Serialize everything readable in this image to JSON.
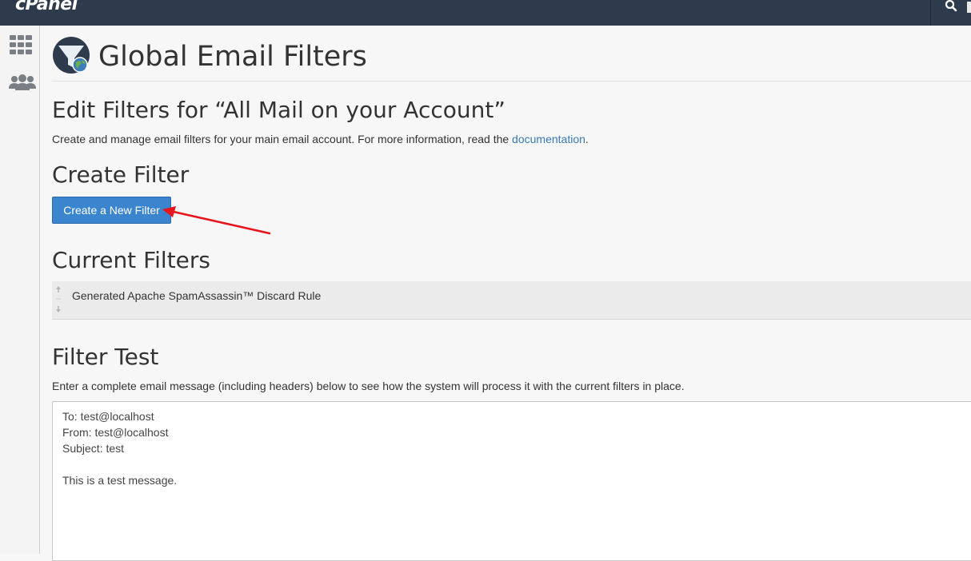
{
  "topbar": {
    "logo_text": "cPanel",
    "search_icon": "search-icon"
  },
  "sidebar": {
    "items": [
      {
        "icon": "grid-icon"
      },
      {
        "icon": "users-icon"
      }
    ]
  },
  "page": {
    "title": "Global Email Filters",
    "icon": "email-filter-icon"
  },
  "edit_section": {
    "heading": "Edit Filters for “All Mail on your Account”",
    "description_prefix": "Create and manage email filters for your main email account. For more information, read the ",
    "doc_link": "documentation",
    "description_suffix": "."
  },
  "create_section": {
    "heading": "Create Filter",
    "button_label": "Create a New Filter"
  },
  "current_section": {
    "heading": "Current Filters",
    "filters": [
      {
        "name": "Generated Apache SpamAssassin™ Discard Rule"
      }
    ]
  },
  "test_section": {
    "heading": "Filter Test",
    "description": "Enter a complete email message (including headers) below to see how the system will process it with the current filters in place.",
    "message": "To: test@localhost\nFrom: test@localhost\nSubject: test\n\nThis is a test message."
  },
  "colors": {
    "topbar": "#2d3b4d",
    "button": "#3b85cf",
    "link": "#3a78b5",
    "annotation_arrow": "#e8131b"
  }
}
